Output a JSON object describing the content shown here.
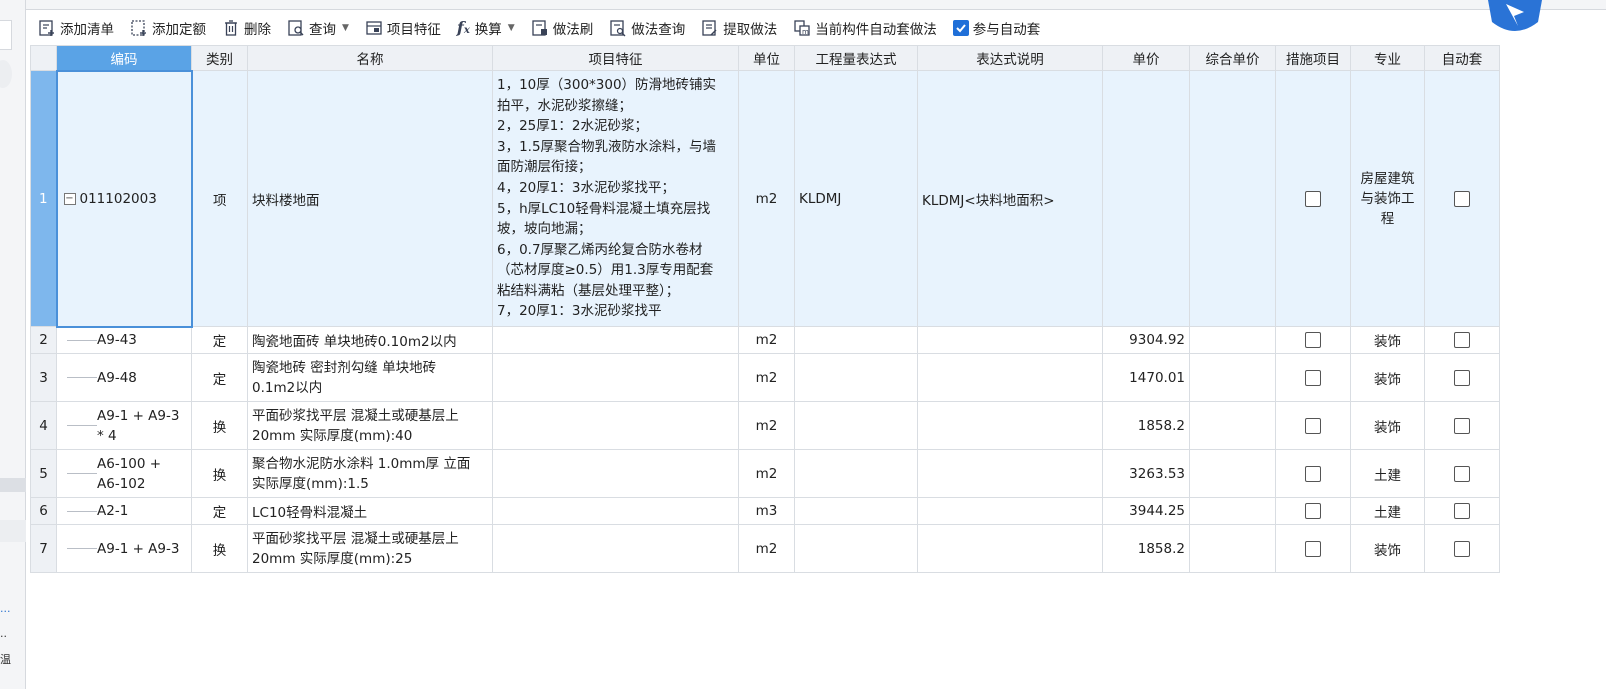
{
  "toolbar": {
    "add_list": "添加清单",
    "add_quota": "添加定额",
    "delete": "删除",
    "query": "查询",
    "item_feature": "项目特征",
    "convert": "换算",
    "method_brush": "做法刷",
    "method_query": "做法查询",
    "extract_method": "提取做法",
    "auto_set_current": "当前构件自动套做法",
    "participate_auto": "参与自动套"
  },
  "left_panel": {
    "ellipsis_1": "...",
    "ellipsis_2": "..",
    "char": "温"
  },
  "table": {
    "columns": [
      "编码",
      "类别",
      "名称",
      "项目特征",
      "单位",
      "工程量表达式",
      "表达式说明",
      "单价",
      "综合单价",
      "措施项目",
      "专业",
      "自动套"
    ],
    "rows": [
      {
        "num": "1",
        "code": "011102003",
        "type": "项",
        "name": "块料楼地面",
        "feature": [
          "1，10厚（300*300）防滑地砖铺实",
          "拍平，水泥砂浆擦缝；",
          "2，25厚1：2水泥砂浆；",
          "3，1.5厚聚合物乳液防水涂料，与墙",
          "面防潮层衔接；",
          "4，20厚1：3水泥砂浆找平；",
          "5，h厚LC10轻骨料混凝土填充层找",
          "坡，坡向地漏；",
          "6，0.7厚聚乙烯丙纶复合防水卷材",
          "（芯材厚度≥0.5）用1.3厚专用配套",
          "粘结料满粘（基层处理平整）；",
          "7，20厚1：3水泥砂浆找平"
        ],
        "unit": "m2",
        "expr": "KLDMJ",
        "expr_desc": "KLDMJ<块料地面积>",
        "price": "",
        "total_price": "",
        "specialty": [
          "房屋建筑",
          "与装饰工",
          "程"
        ]
      },
      {
        "num": "2",
        "code": [
          "A9-43"
        ],
        "type": "定",
        "name": [
          "陶瓷地面砖 单块地砖0.10m2以内"
        ],
        "unit": "m2",
        "price": "9304.92",
        "specialty": "装饰"
      },
      {
        "num": "3",
        "code": [
          "A9-48"
        ],
        "type": "定",
        "name": [
          "陶瓷地砖 密封剂勾缝 单块地砖",
          "0.1m2以内"
        ],
        "unit": "m2",
        "price": "1470.01",
        "specialty": "装饰"
      },
      {
        "num": "4",
        "code": [
          "A9-1 + A9-3",
          "* 4"
        ],
        "type": "换",
        "name": [
          "平面砂浆找平层 混凝土或硬基层上",
          "20mm  实际厚度(mm):40"
        ],
        "unit": "m2",
        "price": "1858.2",
        "specialty": "装饰"
      },
      {
        "num": "5",
        "code": [
          "A6-100 +",
          "A6-102"
        ],
        "type": "换",
        "name": [
          "聚合物水泥防水涂料 1.0mm厚 立面",
          " 实际厚度(mm):1.5"
        ],
        "unit": "m2",
        "price": "3263.53",
        "specialty": "土建"
      },
      {
        "num": "6",
        "code": [
          "A2-1"
        ],
        "type": "定",
        "name": [
          "LC10轻骨料混凝土"
        ],
        "unit": "m3",
        "price": "3944.25",
        "specialty": "土建"
      },
      {
        "num": "7",
        "code": [
          "A9-1 + A9-3"
        ],
        "type": "换",
        "name": [
          "平面砂浆找平层 混凝土或硬基层上",
          "20mm  实际厚度(mm):25"
        ],
        "unit": "m2",
        "price": "1858.2",
        "specialty": "装饰"
      }
    ]
  }
}
